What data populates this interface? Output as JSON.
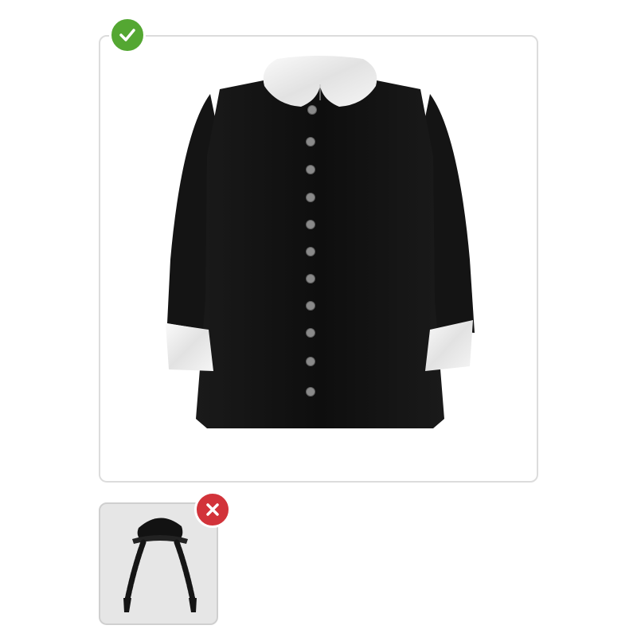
{
  "cards": [
    {
      "item": "dress",
      "status": "included",
      "status_icon": "check-icon",
      "status_color": "#54a732"
    },
    {
      "item": "braided-wig-cap",
      "status": "not-included",
      "status_icon": "cross-icon",
      "status_color": "#d2333a"
    }
  ],
  "colors": {
    "card_border": "#dcdcdc",
    "dress": "#111111",
    "collar": "#f0f0f0"
  }
}
